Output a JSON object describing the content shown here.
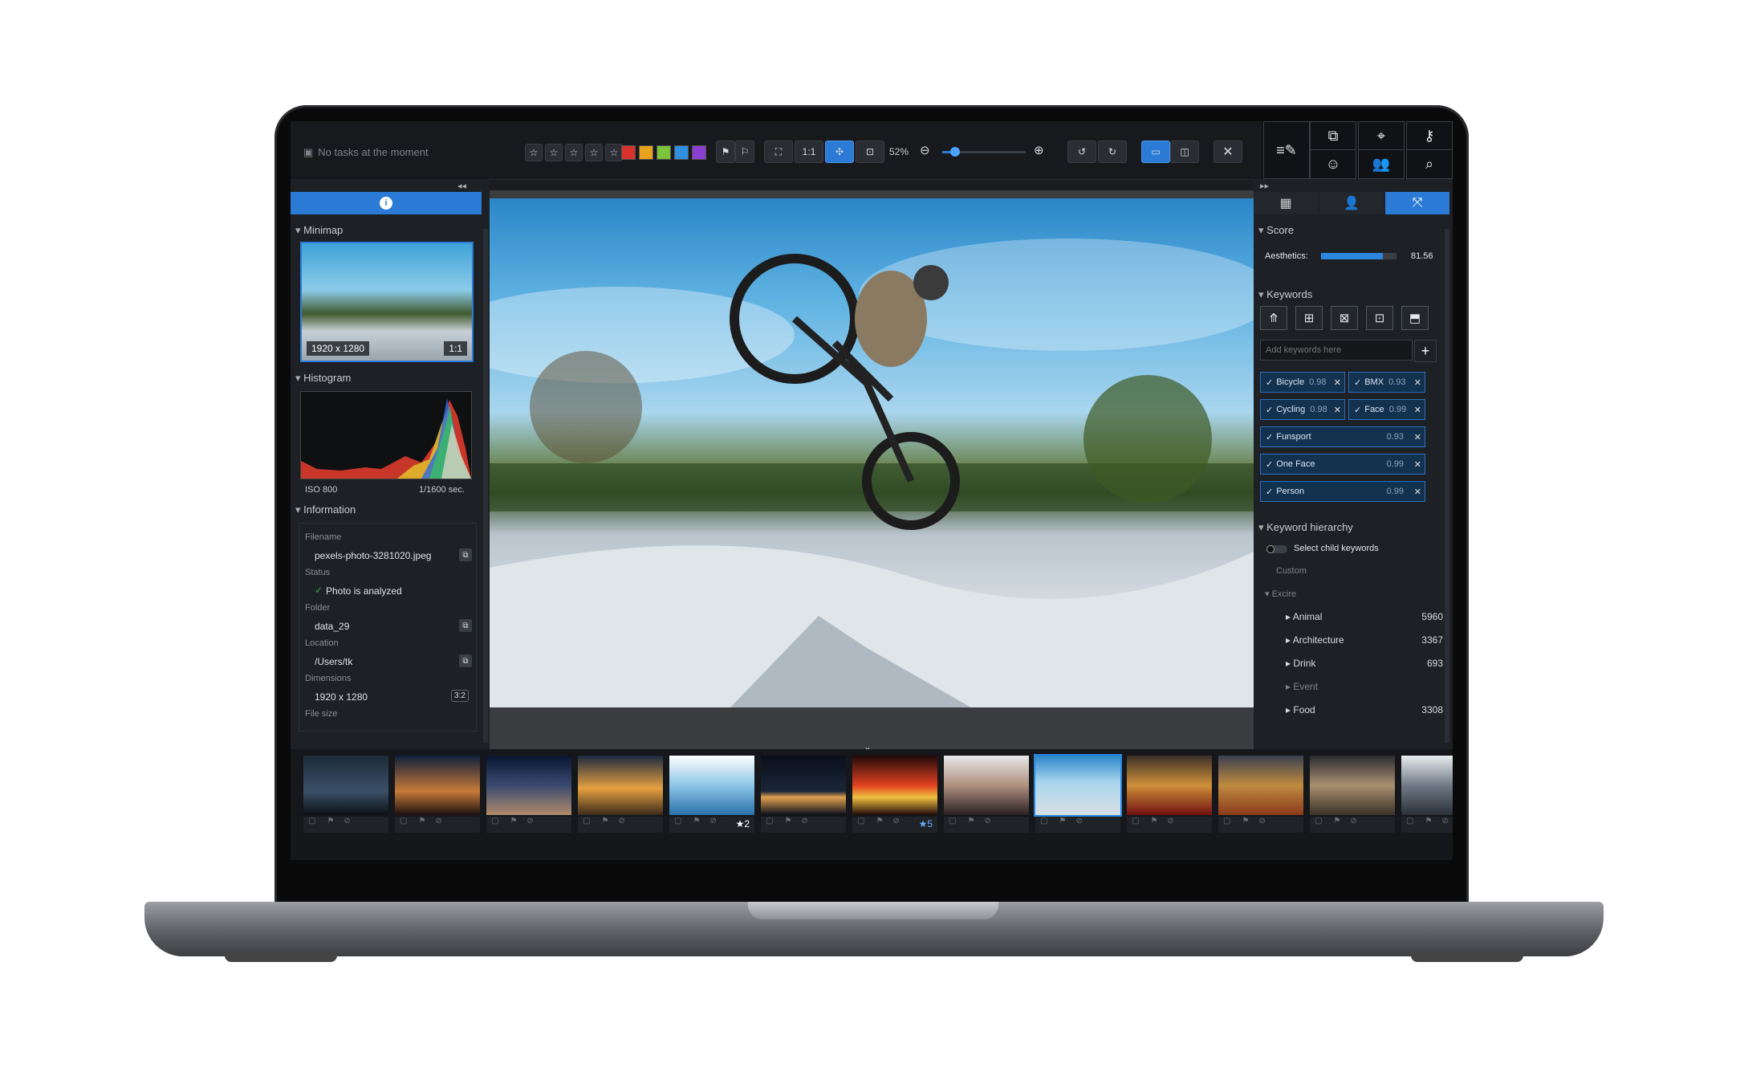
{
  "toolbar": {
    "tasks_label": "No tasks at the moment",
    "zoom_1to1": "1:1",
    "zoom_percent": "52%",
    "zoom_level": 0.52,
    "stars": [
      "☆",
      "☆",
      "☆",
      "☆",
      "☆"
    ],
    "color_labels": [
      "#d9322e",
      "#e8a21b",
      "#7cc43a",
      "#2f8fe0",
      "#8a3fd0"
    ]
  },
  "left_panel": {
    "minimap_title": "Minimap",
    "minimap_dims": "1920 x 1280",
    "minimap_ratio": "1:1",
    "histogram_title": "Histogram",
    "iso": "ISO 800",
    "shutter": "1/1600 sec.",
    "information_title": "Information",
    "info": {
      "filename_label": "Filename",
      "filename": "pexels-photo-3281020.jpeg",
      "status_label": "Status",
      "status": "Photo is analyzed",
      "folder_label": "Folder",
      "folder": "data_29",
      "location_label": "Location",
      "location": "/Users/tk",
      "dimensions_label": "Dimensions",
      "dimensions": "1920 x 1280",
      "aspect": "3:2",
      "filesize_label": "File size"
    }
  },
  "right_panel": {
    "score_title": "Score",
    "aesthetics_label": "Aesthetics:",
    "aesthetics_value": "81.56",
    "aesthetics_fraction": 0.8156,
    "keywords_title": "Keywords",
    "keywords_placeholder": "Add keywords here",
    "keywords": [
      {
        "name": "Bicycle",
        "score": "0.98"
      },
      {
        "name": "BMX",
        "score": "0.93"
      },
      {
        "name": "Cycling",
        "score": "0.98"
      },
      {
        "name": "Face",
        "score": "0.99"
      },
      {
        "name": "Funsport",
        "score": "0.93"
      },
      {
        "name": "One Face",
        "score": "0.99"
      },
      {
        "name": "Person",
        "score": "0.99"
      }
    ],
    "hierarchy_title": "Keyword hierarchy",
    "select_child_label": "Select child keywords",
    "custom_label": "Custom",
    "excire_label": "Excire",
    "tree": [
      {
        "name": "Animal",
        "count": "5960"
      },
      {
        "name": "Architecture",
        "count": "3367"
      },
      {
        "name": "Drink",
        "count": "693"
      },
      {
        "name": "Event",
        "count": ""
      },
      {
        "name": "Food",
        "count": "3308"
      }
    ]
  },
  "filmstrip": {
    "badges": [
      {
        "index": 4,
        "text": "★2"
      },
      {
        "index": 6,
        "text": "★5"
      }
    ]
  },
  "icons": {
    "info": "info-icon",
    "edit": "edit-list-icon"
  }
}
